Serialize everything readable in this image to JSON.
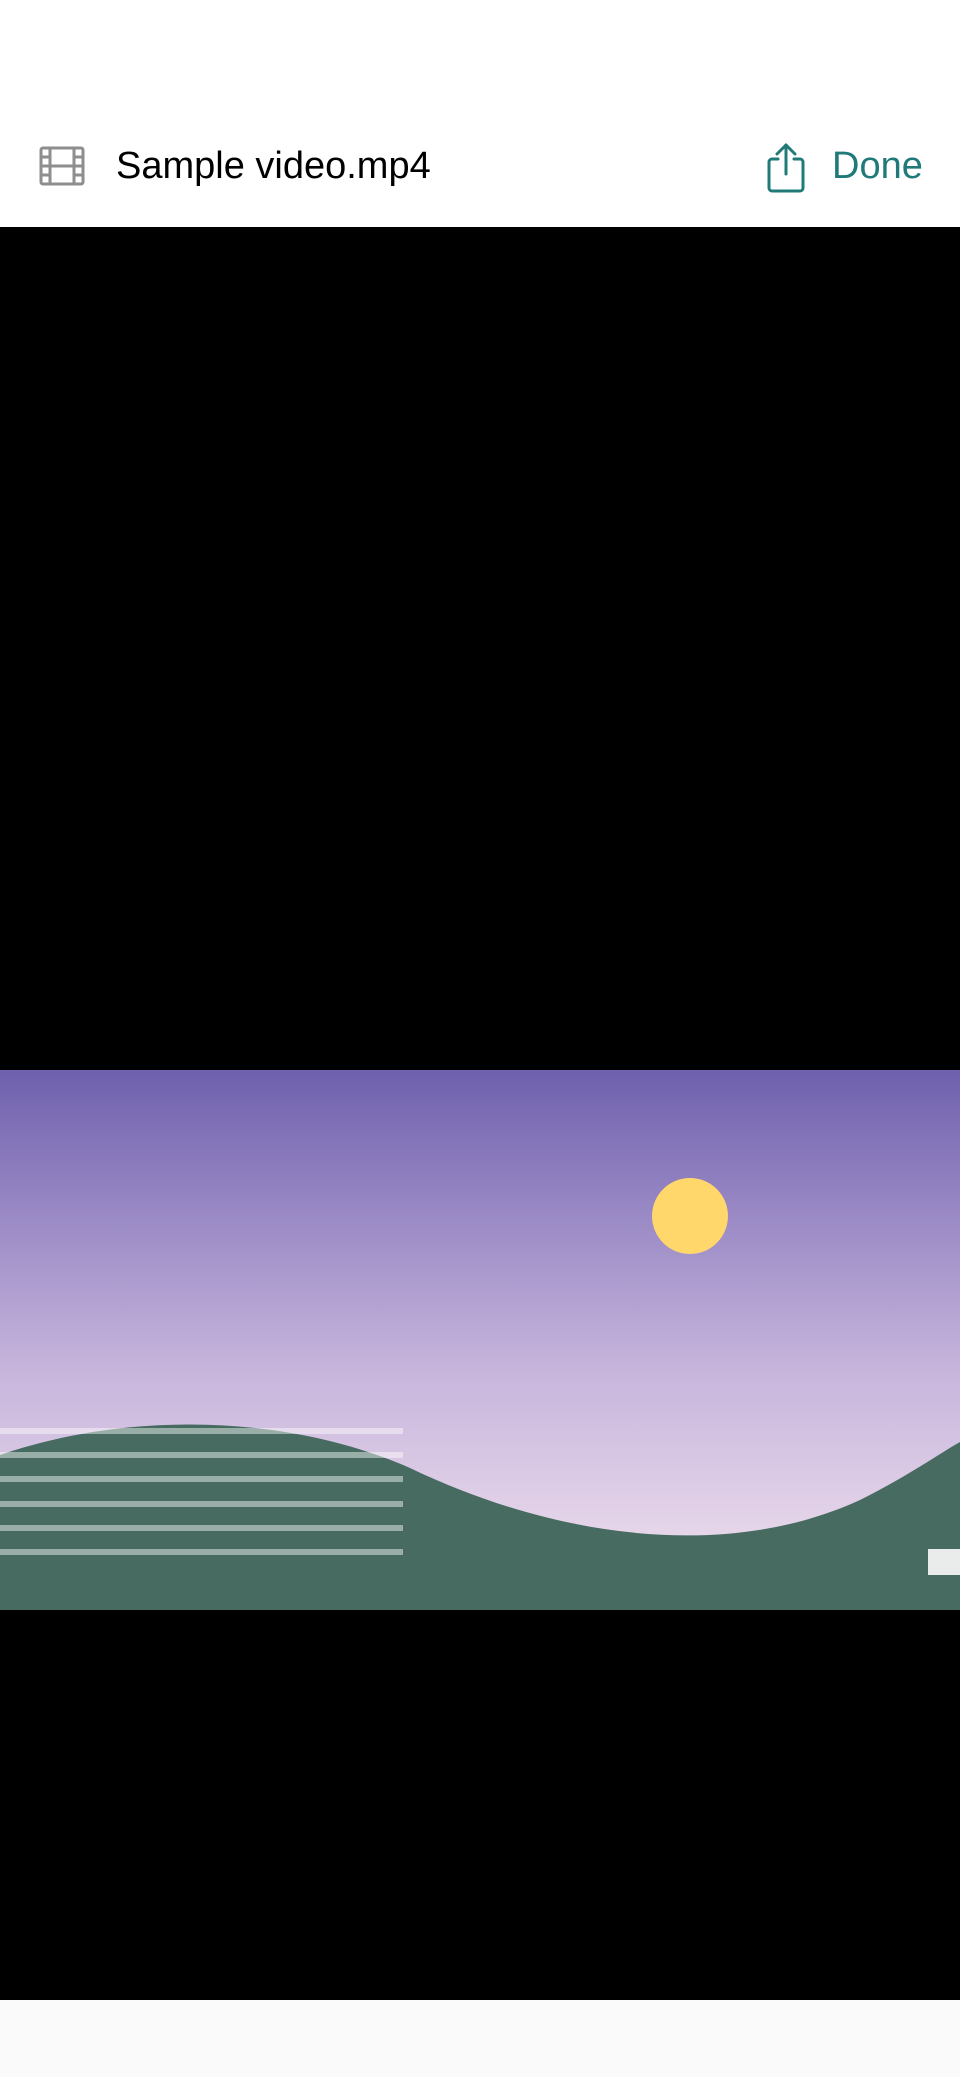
{
  "header": {
    "file_icon": "film-icon",
    "title": "Sample video.mp4",
    "share_icon": "share-icon",
    "done_label": "Done",
    "accent_color": "#1f7a78"
  },
  "video": {
    "background_color": "#000000",
    "thumbnail_colors": {
      "sky_top": "#6f60ae",
      "sky_bottom": "#eadaeb",
      "sun": "#ffd76a",
      "hill": "#476b60"
    }
  }
}
